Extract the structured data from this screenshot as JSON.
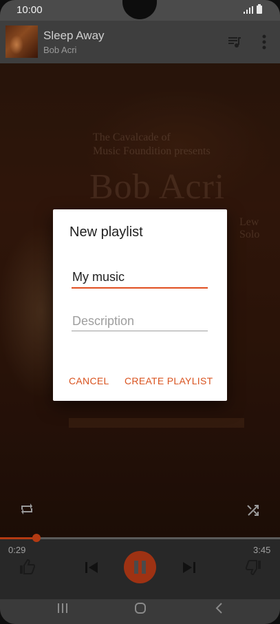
{
  "status_bar": {
    "time": "10:00"
  },
  "now_playing": {
    "title": "Sleep Away",
    "artist": "Bob Acri"
  },
  "album_art": {
    "line1": "The Cavalcade of",
    "line2": "Music Foundition presents",
    "big_text": "Bob Acri with",
    "small_text": "Lew Solo"
  },
  "player": {
    "elapsed": "0:29",
    "total": "3:45",
    "progress": 0.129,
    "accent_color": "#b43a12"
  },
  "dialog": {
    "title": "New playlist",
    "name_value": "My music",
    "description_placeholder": "Description",
    "cancel_label": "CANCEL",
    "create_label": "CREATE PLAYLIST"
  },
  "icons": [
    "queue-music-icon",
    "more-vert-icon",
    "repeat-icon",
    "shuffle-icon",
    "thumb-up-icon",
    "skip-previous-icon",
    "pause-icon",
    "skip-next-icon",
    "thumb-down-icon",
    "recent-apps-icon",
    "home-icon",
    "back-icon"
  ]
}
